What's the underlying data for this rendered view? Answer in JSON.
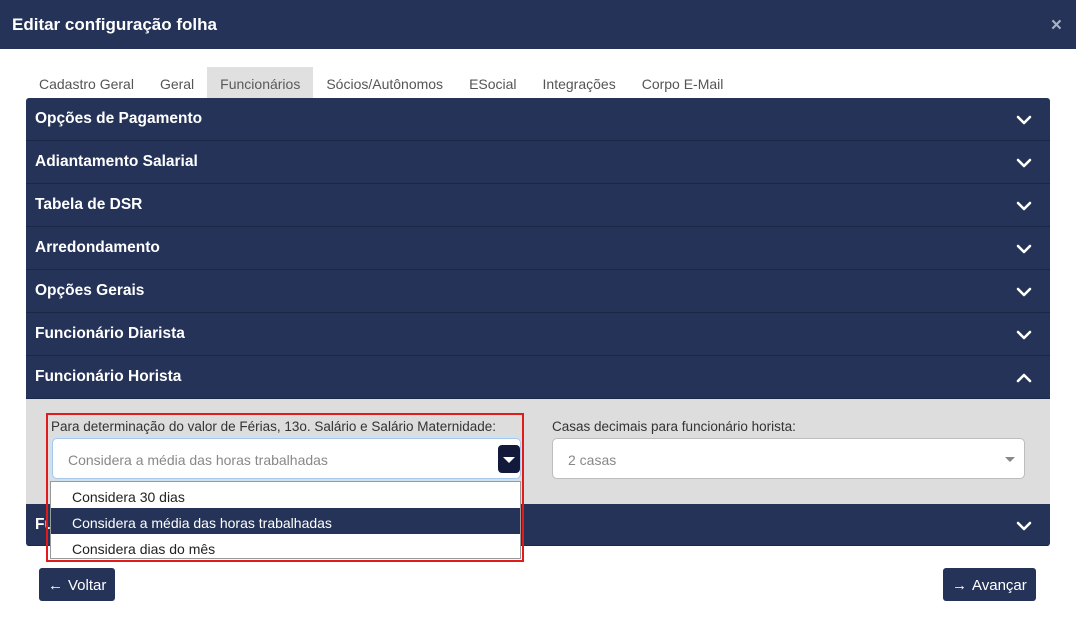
{
  "window": {
    "title": "Editar configuração folha",
    "close_icon": "×"
  },
  "tabs": [
    {
      "label": "Cadastro Geral",
      "active": false
    },
    {
      "label": "Geral",
      "active": false
    },
    {
      "label": "Funcionários",
      "active": true
    },
    {
      "label": "Sócios/Autônomos",
      "active": false
    },
    {
      "label": "ESocial",
      "active": false
    },
    {
      "label": "Integrações",
      "active": false
    },
    {
      "label": "Corpo E-Mail",
      "active": false
    }
  ],
  "sections": [
    {
      "label": "Opções de Pagamento",
      "expanded": false
    },
    {
      "label": "Adiantamento Salarial",
      "expanded": false
    },
    {
      "label": "Tabela de DSR",
      "expanded": false
    },
    {
      "label": "Arredondamento",
      "expanded": false
    },
    {
      "label": "Opções Gerais",
      "expanded": false
    },
    {
      "label": "Funcionário Diarista",
      "expanded": false
    },
    {
      "label": "Funcionário Horista",
      "expanded": true
    },
    {
      "label": "Fu",
      "expanded": false
    }
  ],
  "horista": {
    "ferias_label": "Para determinação do valor de Férias, 13o. Salário e Salário Maternidade:",
    "ferias_value": "Considera a média das horas trabalhadas",
    "ferias_options": [
      {
        "label": "Considera 30 dias",
        "selected": false
      },
      {
        "label": "Considera a média das horas trabalhadas",
        "selected": true
      },
      {
        "label": "Considera dias do mês",
        "selected": false
      }
    ],
    "casas_label": "Casas decimais para funcionário horista:",
    "casas_value": "2 casas"
  },
  "footer": {
    "back_label": "Voltar",
    "next_label": "Avançar"
  },
  "colors": {
    "primary": "#253358",
    "tab_active_bg": "#e0e0e0",
    "body_bg": "#dddddd",
    "highlight": "#e01b1b"
  }
}
